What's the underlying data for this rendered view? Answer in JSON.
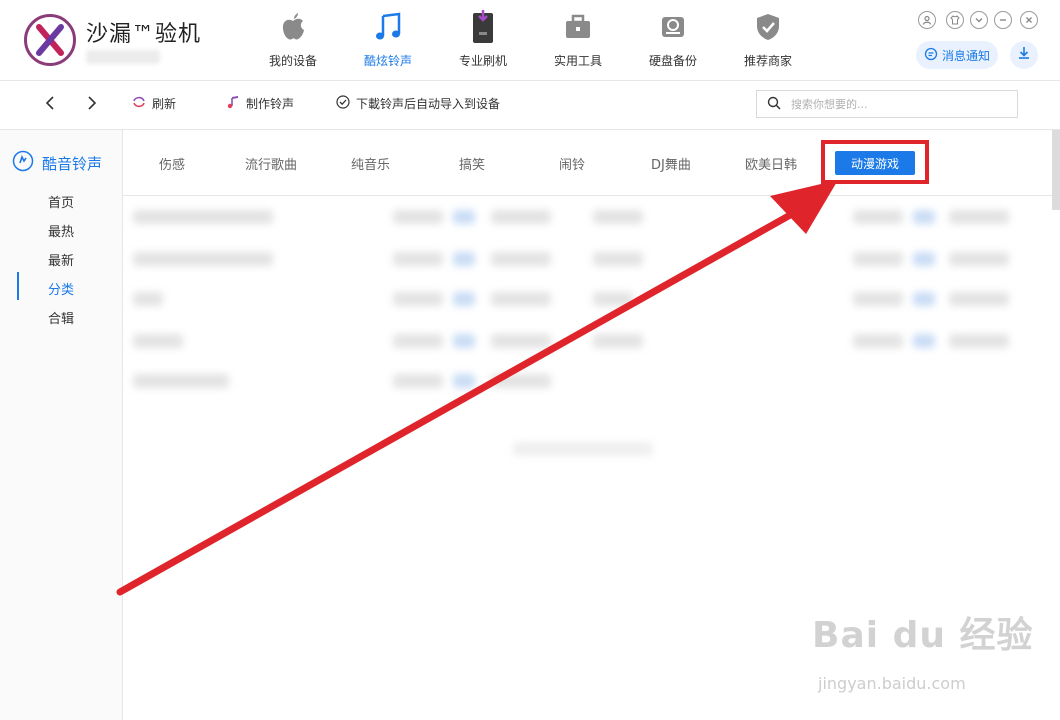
{
  "app": {
    "title": "沙漏™验机"
  },
  "nav": [
    {
      "label": "我的设备",
      "icon": "apple-icon"
    },
    {
      "label": "酷炫铃声",
      "icon": "music-note-icon",
      "active": true
    },
    {
      "label": "专业刷机",
      "icon": "phone-flash-icon"
    },
    {
      "label": "实用工具",
      "icon": "toolbox-icon"
    },
    {
      "label": "硬盘备份",
      "icon": "disk-backup-icon"
    },
    {
      "label": "推荐商家",
      "icon": "shield-check-icon"
    }
  ],
  "header": {
    "notify_label": "消息通知"
  },
  "toolbar": {
    "refresh_label": "刷新",
    "make_ringtone_label": "制作铃声",
    "auto_import_label": "下載铃声后自动导入到设备",
    "search_placeholder": "搜索你想要的..."
  },
  "sidebar": {
    "heading": "酷音铃声",
    "items": [
      {
        "label": "首页"
      },
      {
        "label": "最热"
      },
      {
        "label": "最新"
      },
      {
        "label": "分类",
        "active": true
      },
      {
        "label": "合辑"
      }
    ]
  },
  "categories": [
    "伤感",
    "流行歌曲",
    "纯音乐",
    "搞笑",
    "闹铃",
    "DJ舞曲",
    "欧美日韩",
    "动漫游戏"
  ],
  "active_category": "动漫游戏",
  "watermark": {
    "brand": "Bai du 经验",
    "url": "jingyan.baidu.com"
  },
  "colors": {
    "accent": "#1b7ae8",
    "highlight": "#e0242b"
  }
}
